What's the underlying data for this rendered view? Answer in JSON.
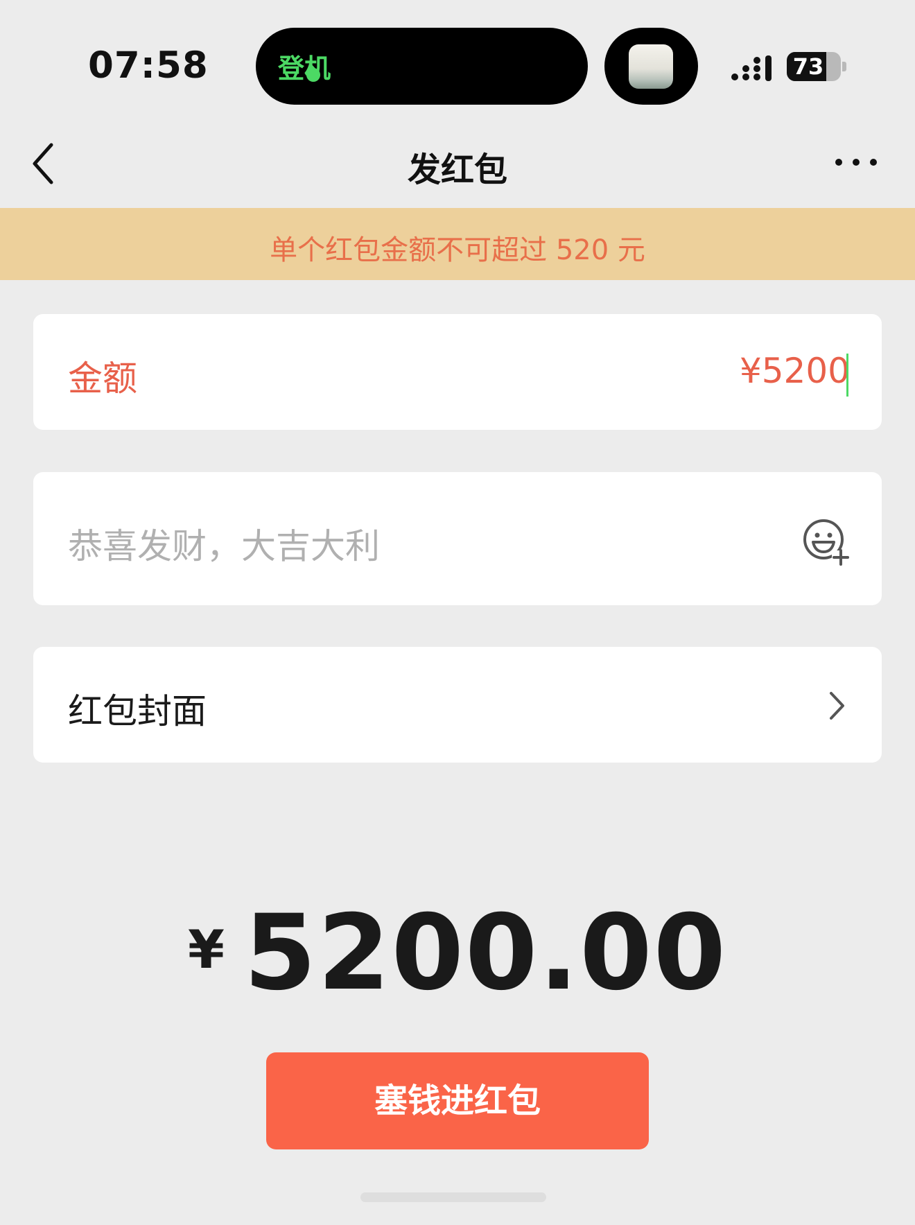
{
  "status_bar": {
    "time": "07:58",
    "island_text": "登机",
    "battery_level": "73",
    "battery_percent": 73
  },
  "nav": {
    "title": "发红包",
    "back_icon": "chevron-left-icon",
    "more_icon": "ellipsis-icon"
  },
  "notice": {
    "text": "单个红包金额不可超过 520 元"
  },
  "amount_field": {
    "label": "金额",
    "value": "¥5200"
  },
  "greeting_field": {
    "placeholder": "恭喜发财，大吉大利",
    "emoji_icon": "emoji-add-icon"
  },
  "cover_row": {
    "label": "红包封面",
    "chevron_icon": "chevron-right-icon"
  },
  "total": {
    "currency": "¥",
    "amount": "5200.00"
  },
  "submit": {
    "label": "塞钱进红包"
  },
  "colors": {
    "background": "#ececec",
    "notice_bg": "#edd09b",
    "accent_red": "#e8604a",
    "button_bg": "#fa6448",
    "island_green": "#4cd964"
  }
}
